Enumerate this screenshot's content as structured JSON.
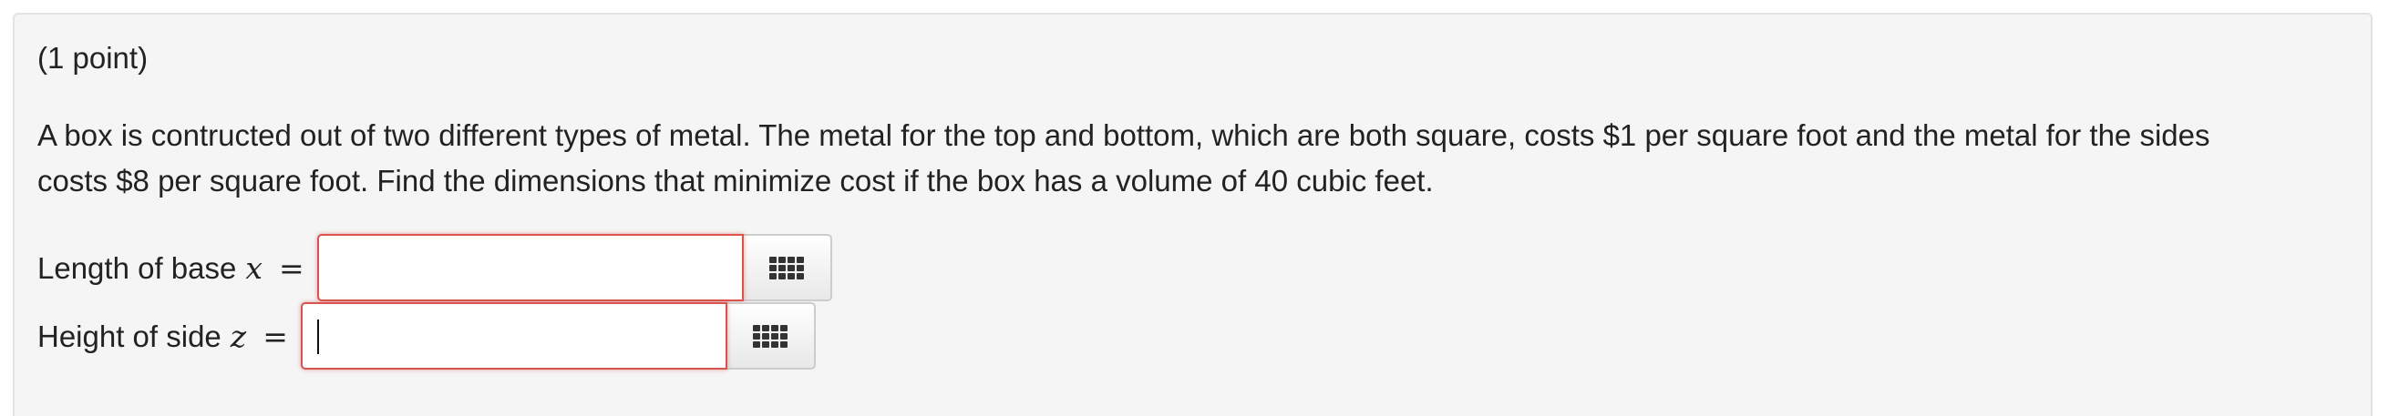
{
  "problem": {
    "points": "(1 point)",
    "statement_line1": "A box is contructed out of two different types of metal. The metal for the top and bottom, which are both square, costs $1 per square foot and the metal for the sides",
    "statement_line2": "costs $8 per square foot. Find the dimensions that minimize cost if the box has a volume of 40 cubic feet."
  },
  "answers": [
    {
      "label": "Length of base",
      "variable": "x",
      "equals": "=",
      "value": "",
      "state": "error",
      "focused": false,
      "palette_icon": "grid-icon"
    },
    {
      "label": "Height of side",
      "variable": "z",
      "equals": "=",
      "value": "",
      "state": "error",
      "focused": true,
      "palette_icon": "grid-icon"
    }
  ],
  "colors": {
    "panel_background": "#f5f5f5",
    "error_border": "#d9534f",
    "text": "#222222"
  }
}
